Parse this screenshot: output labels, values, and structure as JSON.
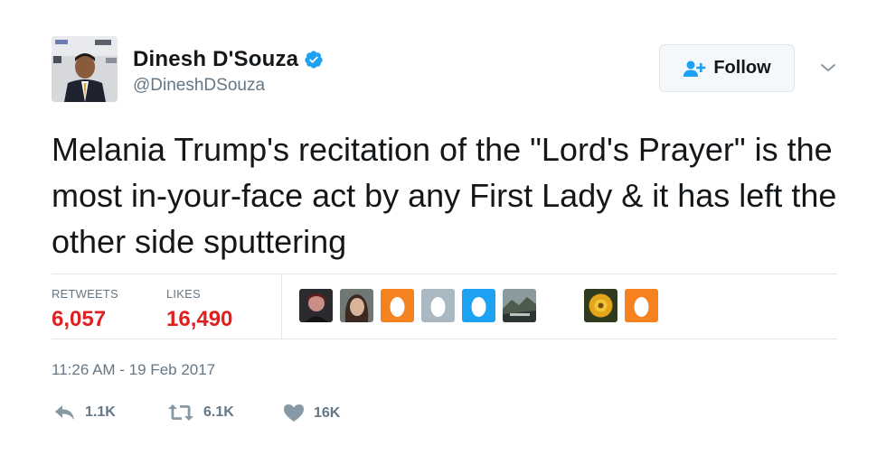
{
  "author": {
    "display_name": "Dinesh D'Souza",
    "handle": "@DineshDSouza",
    "verified": true
  },
  "follow_button": {
    "label": "Follow"
  },
  "tweet": {
    "text": "Melania Trump's recitation of the \"Lord's Prayer\" is the most in-your-face act by any First Lady & it has left the other side sputtering"
  },
  "stats": {
    "retweets_label": "RETWEETS",
    "retweets_value": "6,057",
    "likes_label": "LIKES",
    "likes_value": "16,490"
  },
  "timestamp": "11:26 AM - 19 Feb 2017",
  "actions": {
    "reply_count": "1.1K",
    "retweet_count": "6.1K",
    "like_count": "16K"
  },
  "colors": {
    "text": "#14171a",
    "secondary": "#657786",
    "verified": "#1da1f2",
    "stat_value": "#e02020",
    "egg_orange": "#f5811f",
    "egg_gray": "#aab8c2",
    "egg_blue": "#1da1f2",
    "divider": "#e1e8ed"
  },
  "liker_avatars": [
    "photo",
    "photo",
    "egg-orange",
    "egg-gray",
    "egg-blue",
    "photo-landscape",
    "photo-flower",
    "egg-orange"
  ]
}
